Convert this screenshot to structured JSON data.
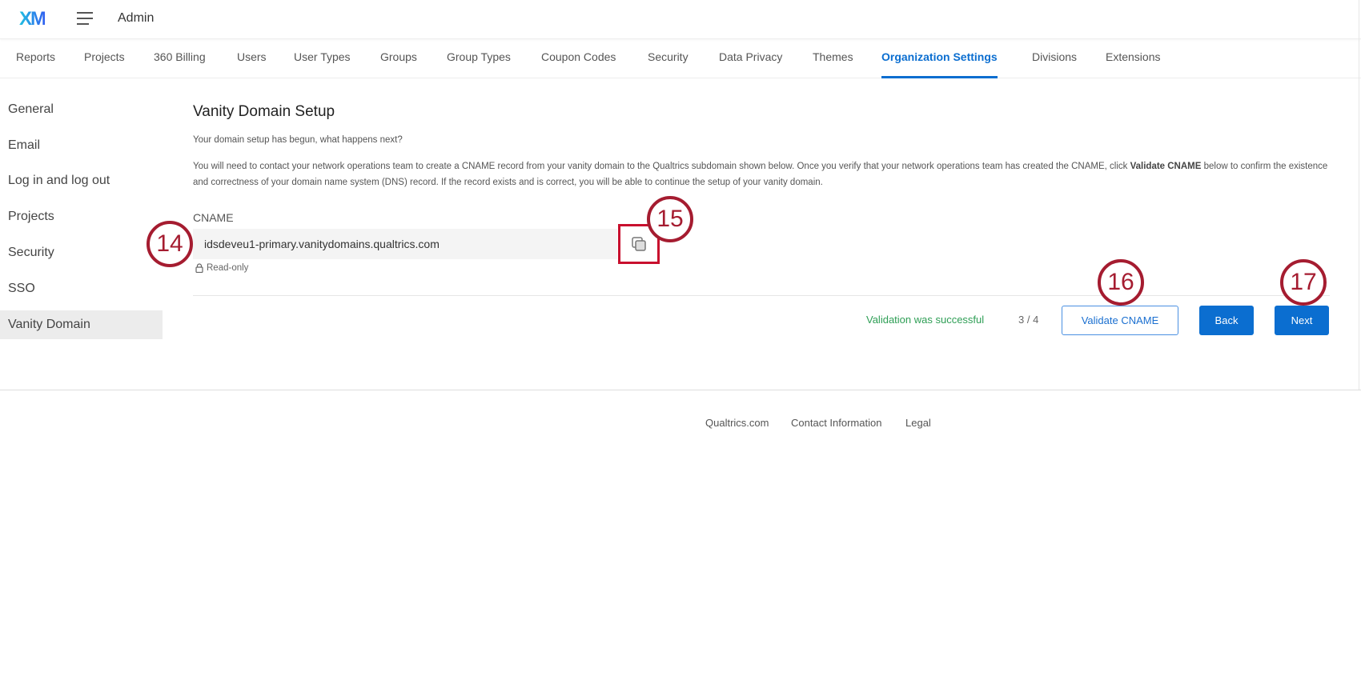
{
  "header": {
    "logo": "XM",
    "app": "Admin"
  },
  "tabs": [
    "Reports",
    "Projects",
    "360 Billing",
    "Users",
    "User Types",
    "Groups",
    "Group Types",
    "Coupon Codes",
    "Security",
    "Data Privacy",
    "Themes",
    "Organization Settings",
    "Divisions",
    "Extensions"
  ],
  "active_tab": "Organization Settings",
  "sidebar": [
    "General",
    "Email",
    "Log in and log out",
    "Projects",
    "Security",
    "SSO",
    "Vanity Domain"
  ],
  "active_sidebar": "Vanity Domain",
  "main": {
    "title": "Vanity Domain Setup",
    "intro": "Your domain setup has begun, what happens next?",
    "para_1": "You will need to contact your network operations team to create a CNAME record from your vanity domain to the Qualtrics subdomain shown below. Once you verify that your network operations team has created the CNAME, click ",
    "para_bold": "Validate CNAME",
    "para_2": " below to confirm the existence and correctness of your domain name system (DNS) record. If the record exists and is correct, you will be able to continue the setup of your vanity domain.",
    "cname_label": "CNAME",
    "cname_value": "idsdeveu1-primary.vanitydomains.qualtrics.com",
    "read_only": "Read-only",
    "status": "Validation was successful",
    "step": "3 / 4",
    "validate_label": "Validate CNAME",
    "back_label": "Back",
    "next_label": "Next"
  },
  "footer": {
    "links": [
      "Qualtrics.com",
      "Contact Information",
      "Legal"
    ]
  },
  "annotations": [
    "14",
    "15",
    "16",
    "17"
  ],
  "colors": {
    "accent": "#0b6ed0",
    "success": "#2e9e55",
    "annotation": "#a51c30"
  }
}
